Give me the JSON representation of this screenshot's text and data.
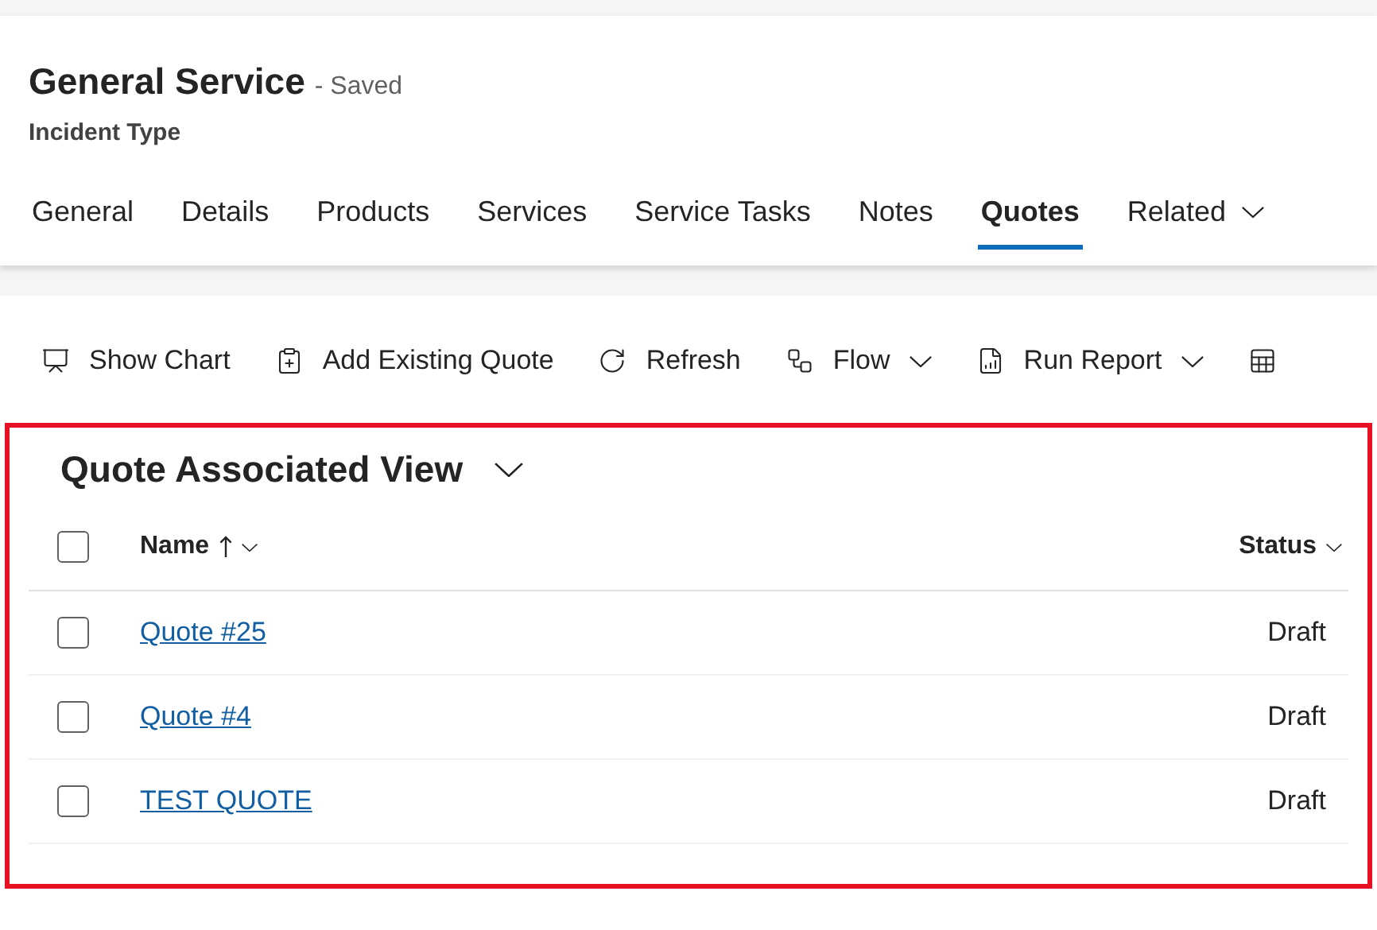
{
  "record": {
    "title": "General Service",
    "save_state": "- Saved",
    "entity": "Incident Type"
  },
  "tabs": [
    {
      "label": "General",
      "selected": false,
      "dropdown": false
    },
    {
      "label": "Details",
      "selected": false,
      "dropdown": false
    },
    {
      "label": "Products",
      "selected": false,
      "dropdown": false
    },
    {
      "label": "Services",
      "selected": false,
      "dropdown": false
    },
    {
      "label": "Service Tasks",
      "selected": false,
      "dropdown": false
    },
    {
      "label": "Notes",
      "selected": false,
      "dropdown": false
    },
    {
      "label": "Quotes",
      "selected": true,
      "dropdown": false
    },
    {
      "label": "Related",
      "selected": false,
      "dropdown": true
    }
  ],
  "toolbar": [
    {
      "kind": "chart",
      "label": "Show Chart",
      "dropdown": false
    },
    {
      "kind": "add",
      "label": "Add Existing Quote",
      "dropdown": false
    },
    {
      "kind": "refresh",
      "label": "Refresh",
      "dropdown": false
    },
    {
      "kind": "flow",
      "label": "Flow",
      "dropdown": true
    },
    {
      "kind": "report",
      "label": "Run Report",
      "dropdown": true
    },
    {
      "kind": "excel",
      "dropdown": false
    }
  ],
  "view": {
    "title": "Quote Associated View",
    "select_all": {
      "checked": false
    },
    "columns": [
      {
        "label": "Name",
        "sorted_ascending": true
      },
      {
        "label": "Status",
        "sorted_ascending": false
      }
    ],
    "rows": [
      {
        "name": "Quote #25",
        "status": "Draft",
        "checked": false
      },
      {
        "name": "Quote #4",
        "status": "Draft",
        "checked": false
      },
      {
        "name": "TEST QUOTE",
        "status": "Draft",
        "checked": false
      }
    ]
  }
}
